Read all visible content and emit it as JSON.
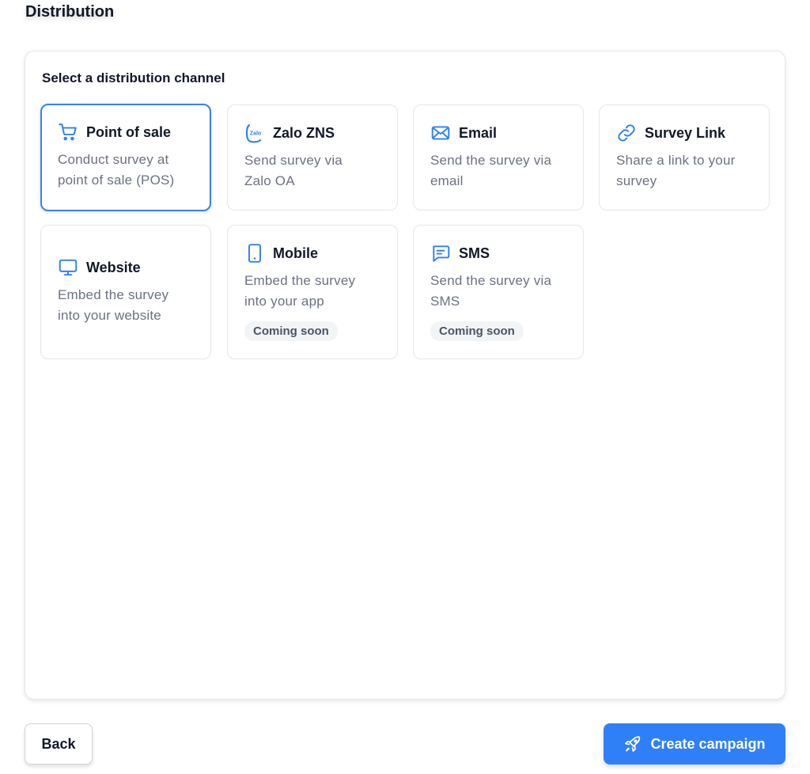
{
  "page": {
    "title": "Distribution"
  },
  "panel": {
    "label": "Select a distribution channel"
  },
  "colors": {
    "accent": "#2f80f6",
    "selected_border": "#3b7ff2",
    "icon": "#2f80f6"
  },
  "channels": [
    {
      "id": "pos",
      "icon": "cart-icon",
      "title": "Point of sale",
      "desc_line1": "Conduct survey at",
      "desc_line2": "point of sale (POS)",
      "selected": true
    },
    {
      "id": "zalo",
      "icon": "zalo-icon",
      "icon_text": "Zalo",
      "title": "Zalo ZNS",
      "desc_line1": "Send survey via",
      "desc_line2": "Zalo OA"
    },
    {
      "id": "email",
      "icon": "mail-icon",
      "title": "Email",
      "desc_line1": "Send the survey via",
      "desc_line2": "email"
    },
    {
      "id": "link",
      "icon": "link-icon",
      "title": "Survey Link",
      "desc_line1": "Share a link to your",
      "desc_line2": "survey"
    },
    {
      "id": "website",
      "icon": "monitor-icon",
      "title": "Website",
      "desc_line1": "Embed the survey",
      "desc_line2": "into your website"
    },
    {
      "id": "mobile",
      "icon": "phone-icon",
      "title": "Mobile",
      "desc_line1": "Embed the survey",
      "desc_line2": "into your app",
      "badge": "Coming soon"
    },
    {
      "id": "sms",
      "icon": "message-icon",
      "title": "SMS",
      "desc_line1": "Send the survey via",
      "desc_line2": "SMS",
      "badge": "Coming soon"
    }
  ],
  "footer": {
    "back_label": "Back",
    "create_label": "Create campaign"
  }
}
